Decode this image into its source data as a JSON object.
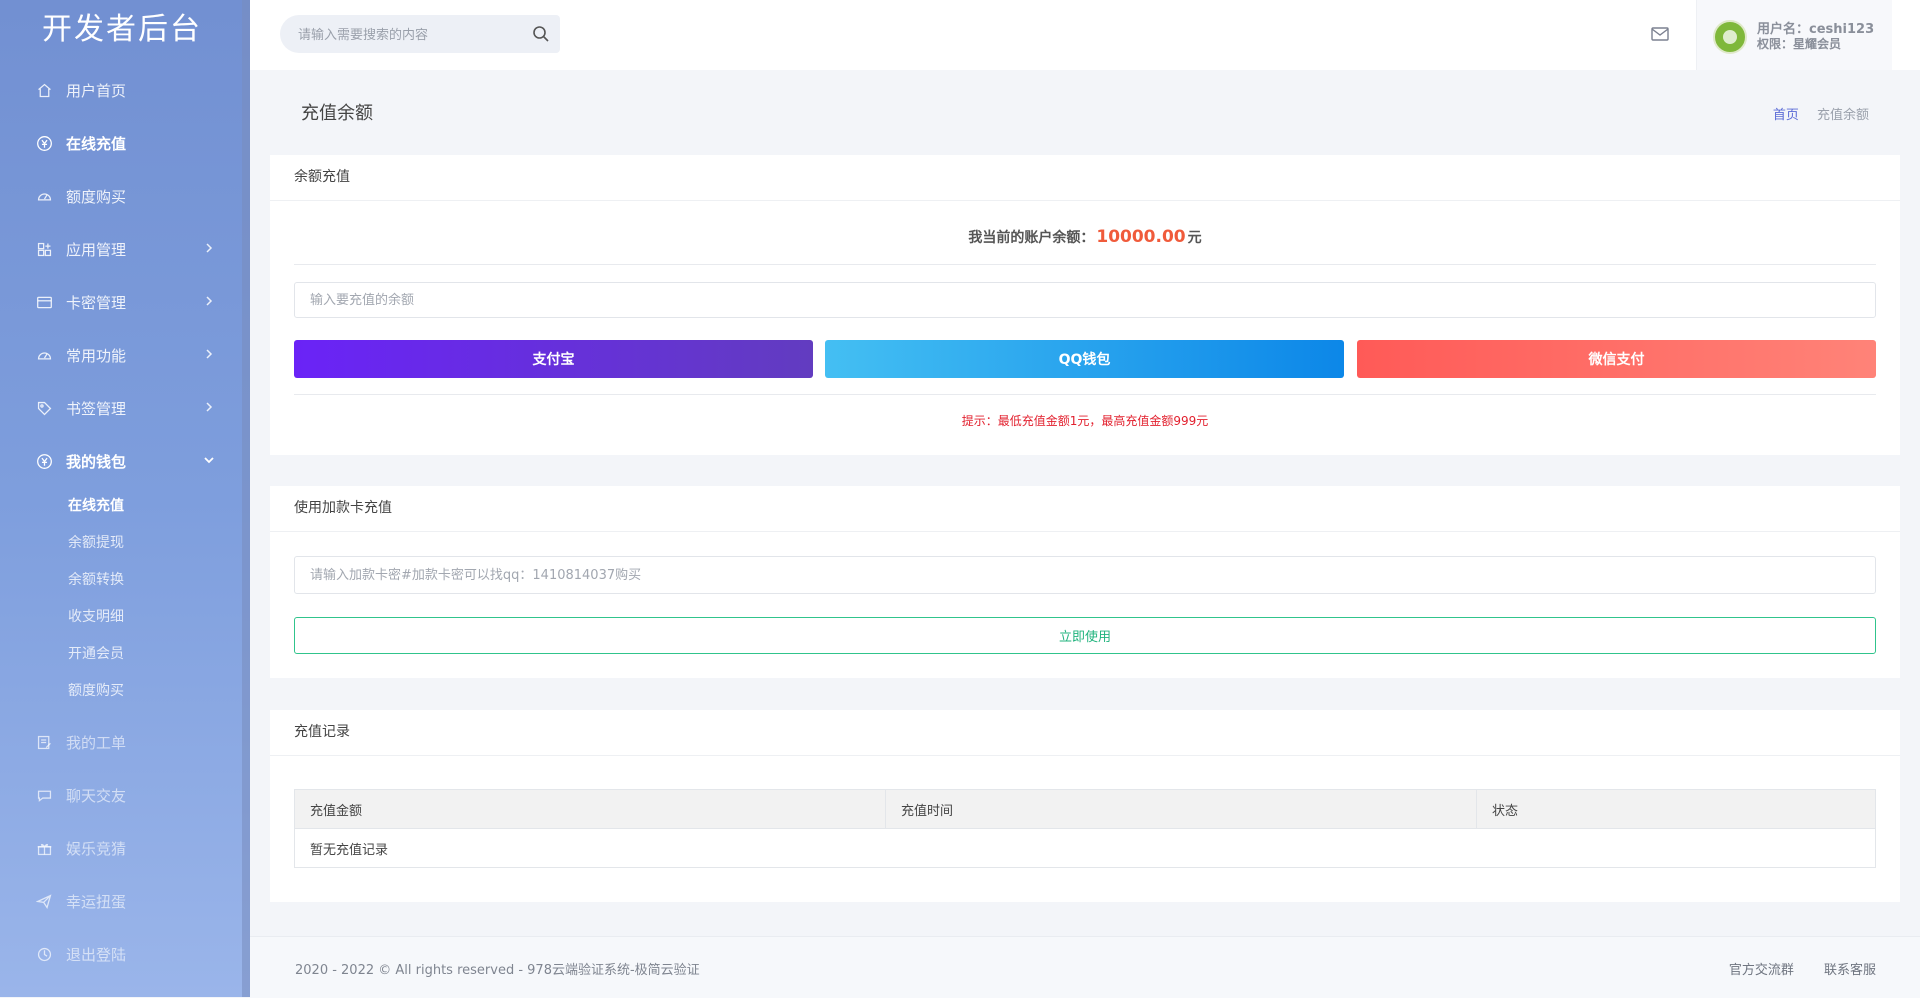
{
  "sidebar": {
    "brand": "开发者后台",
    "items": [
      {
        "label": "用户首页",
        "icon": "home-icon"
      },
      {
        "label": "在线充值",
        "icon": "yen-circle-icon"
      },
      {
        "label": "额度购买",
        "icon": "gauge-icon"
      },
      {
        "label": "应用管理",
        "icon": "apps-icon"
      },
      {
        "label": "卡密管理",
        "icon": "card-icon"
      },
      {
        "label": "常用功能",
        "icon": "gauge-icon"
      },
      {
        "label": "书签管理",
        "icon": "tag-icon"
      },
      {
        "label": "我的钱包",
        "icon": "yen-circle-icon"
      }
    ],
    "wallet_sub": [
      "在线充值",
      "余额提现",
      "余额转换",
      "收支明细",
      "开通会员",
      "额度购买"
    ],
    "items_after": [
      {
        "label": "我的工单",
        "icon": "ticket-icon"
      },
      {
        "label": "聊天交友",
        "icon": "chat-icon"
      },
      {
        "label": "娱乐竞猜",
        "icon": "gift-icon"
      },
      {
        "label": "幸运扭蛋",
        "icon": "send-icon"
      },
      {
        "label": "退出登陆",
        "icon": "power-icon"
      }
    ]
  },
  "topbar": {
    "search_placeholder": "请输入需要搜索的内容",
    "username": "用户名：ceshi123",
    "role": "权限：星耀会员"
  },
  "page": {
    "title": "充值余额",
    "breadcrumb_home": "首页",
    "breadcrumb_current": "充值余额"
  },
  "recharge": {
    "title": "余额充值",
    "balance_label": "我当前的账户余额：",
    "balance_value": "10000.00",
    "balance_unit": "元",
    "amount_placeholder": "输入要充值的余额",
    "alipay": "支付宝",
    "qq": "QQ钱包",
    "wechat": "微信支付",
    "tip": "提示：最低充值金额1元，最高充值金额999元"
  },
  "card_recharge": {
    "title": "使用加款卡充值",
    "placeholder": "请输入加款卡密#加款卡密可以找qq：1410814037购买",
    "button": "立即使用"
  },
  "records": {
    "title": "充值记录",
    "columns": [
      "充值金额",
      "充值时间",
      "状态"
    ],
    "empty": "暂无充值记录"
  },
  "footer": {
    "copyright": "2020 - 2022 © All rights reserved - 978云端验证系统-极简云验证",
    "link_group": "官方交流群",
    "link_service": "联系客服"
  },
  "colors": {
    "brand": "#6f8fd3",
    "balance": "#f05b3b",
    "tip": "#e2202e",
    "use_button": "#20b37d"
  }
}
